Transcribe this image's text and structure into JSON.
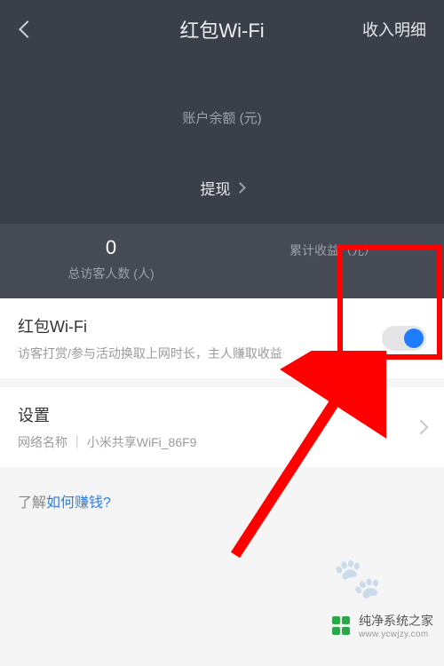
{
  "nav": {
    "title": "红包Wi-Fi",
    "action": "收入明细"
  },
  "balance": {
    "label": "账户余额 (元)"
  },
  "withdraw": {
    "label": "提现"
  },
  "stats": {
    "visitors": {
      "value": "0",
      "label": "总访客人数 (人)"
    },
    "earnings": {
      "value": "",
      "label": "累计收益（元）"
    }
  },
  "hongbao": {
    "title": "红包Wi-Fi",
    "subtitle": "访客打赏/参与活动换取上网时长，主人赚取收益",
    "enabled": true
  },
  "settings": {
    "title": "设置",
    "network_prefix": "网络名称 ｜  ",
    "network_name": "小米共享WiFi_86F9"
  },
  "footer": {
    "prefix": "了解",
    "link": "如何赚钱?"
  },
  "watermark": {
    "cn": "纯净系统之家",
    "en": "www.ycwjzy.com"
  },
  "colors": {
    "accent": "#1f7cff",
    "annot": "#ff0000"
  }
}
